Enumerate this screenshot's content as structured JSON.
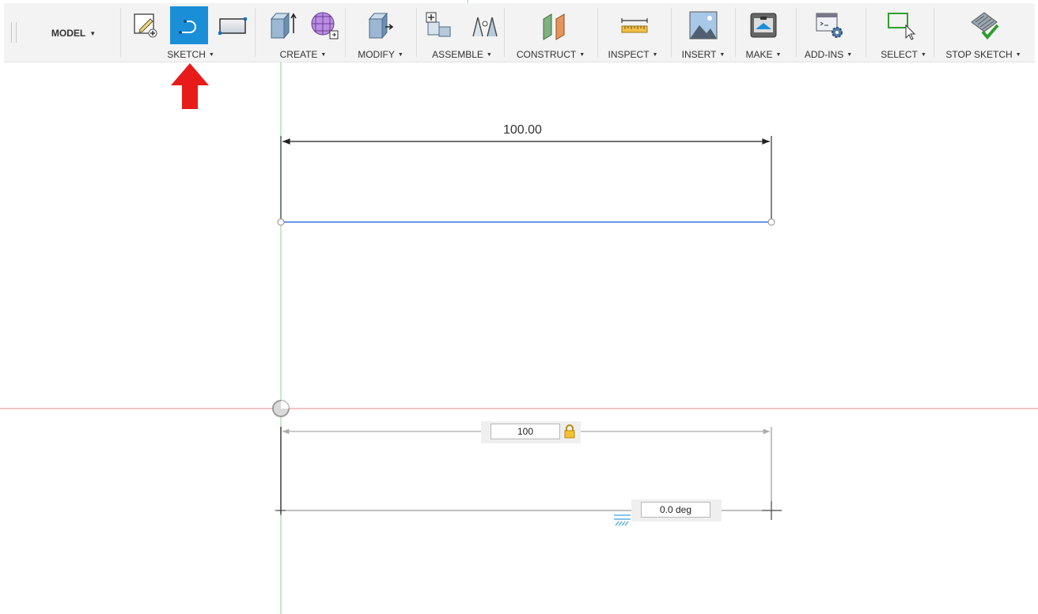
{
  "workspace": {
    "label": "MODEL"
  },
  "toolbar": {
    "groups": [
      {
        "label": "SKETCH"
      },
      {
        "label": "CREATE"
      },
      {
        "label": "MODIFY"
      },
      {
        "label": "ASSEMBLE"
      },
      {
        "label": "CONSTRUCT"
      },
      {
        "label": "INSPECT"
      },
      {
        "label": "INSERT"
      },
      {
        "label": "MAKE"
      },
      {
        "label": "ADD-INS"
      },
      {
        "label": "SELECT"
      },
      {
        "label": "STOP SKETCH"
      }
    ]
  },
  "canvas": {
    "dimension_label": "100.00",
    "length_input": "100",
    "angle_input": "0.0 deg"
  },
  "colors": {
    "accent": "#1a8fd8",
    "sketch_line": "#6e96e6",
    "x_axis": "#f0a0a0",
    "y_axis": "#9fdc9f",
    "annotation": "#e81b1b"
  }
}
